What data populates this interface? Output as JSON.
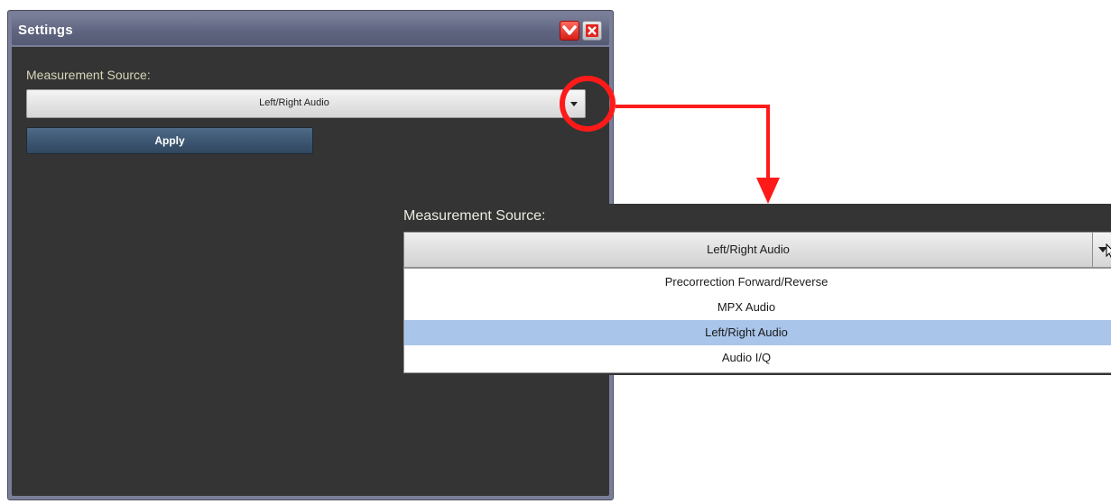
{
  "settings_panel": {
    "title": "Settings",
    "measurement_source_label": "Measurement Source:",
    "selected_value": "Left/Right Audio",
    "apply_label": "Apply"
  },
  "zoom_inset": {
    "measurement_source_label": "Measurement Source:",
    "selected_value": "Left/Right Audio",
    "options": [
      {
        "label": "Precorrection Forward/Reverse",
        "selected": false
      },
      {
        "label": "MPX Audio",
        "selected": false
      },
      {
        "label": "Left/Right Audio",
        "selected": true
      },
      {
        "label": "Audio I/Q",
        "selected": false
      }
    ]
  },
  "colors": {
    "panel_body": "#343434",
    "panel_frame": "#7a7e98",
    "label_text": "#d8d5b8",
    "apply_button": "#3c5571",
    "apply_text": "#ffffff",
    "selected_option": "#a9c5ea",
    "annotation_red": "#ff1a1a"
  },
  "icons": {
    "collapse": "chevron-down-icon",
    "close": "close-icon",
    "dropdown": "caret-down-icon",
    "cursor": "mouse-pointer-icon"
  }
}
